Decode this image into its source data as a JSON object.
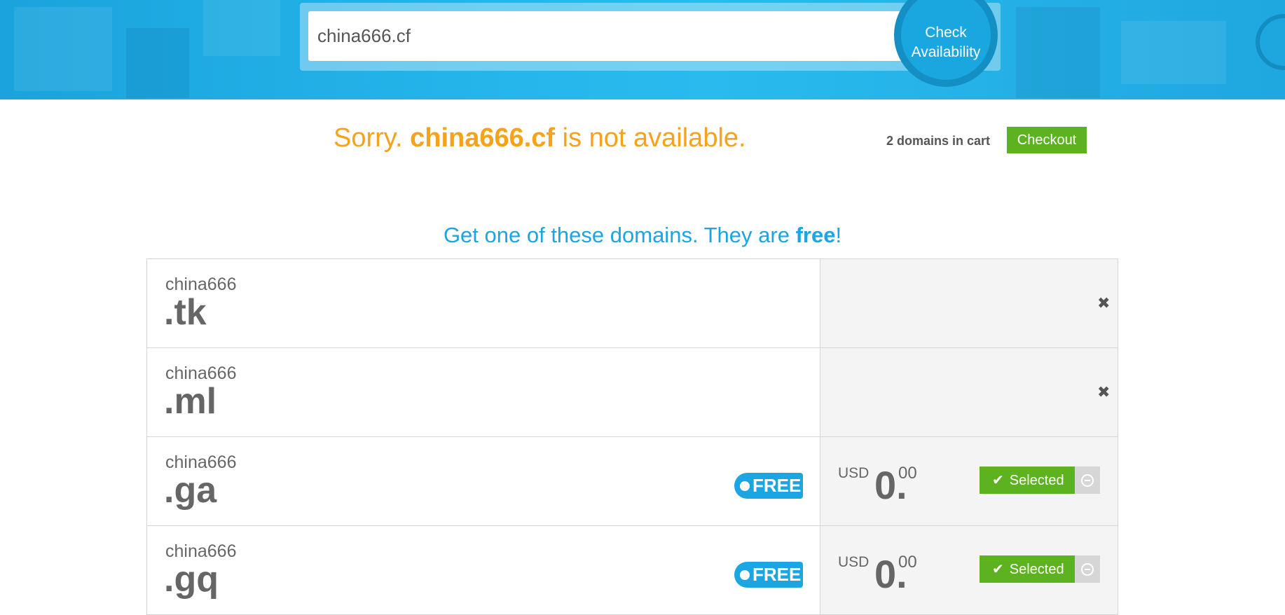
{
  "search": {
    "value": "china666.cf",
    "check_button": "Check Availability"
  },
  "status": {
    "sorry_prefix": "Sorry. ",
    "domain": "china666.cf",
    "sorry_suffix": " is not available."
  },
  "cart": {
    "count_text": "2 domains in cart",
    "checkout_label": "Checkout"
  },
  "offer": {
    "prefix": "Get one of these domains. They are ",
    "free_word": "free",
    "suffix": "!"
  },
  "domains": [
    {
      "sld": "china666",
      "tld": ".tk",
      "state": "unavailable"
    },
    {
      "sld": "china666",
      "tld": ".ml",
      "state": "unavailable"
    },
    {
      "sld": "china666",
      "tld": ".ga",
      "state": "selected",
      "badge": "FREE",
      "currency": "USD",
      "price_int": "0.",
      "price_dec": "00",
      "selected_label": "Selected"
    },
    {
      "sld": "china666",
      "tld": ".gq",
      "state": "selected",
      "badge": "FREE",
      "currency": "USD",
      "price_int": "0.",
      "price_dec": "00",
      "selected_label": "Selected"
    }
  ],
  "colors": {
    "accent_blue": "#1ba5e2",
    "warning_orange": "#f7a21b",
    "success_green": "#5db31f"
  }
}
